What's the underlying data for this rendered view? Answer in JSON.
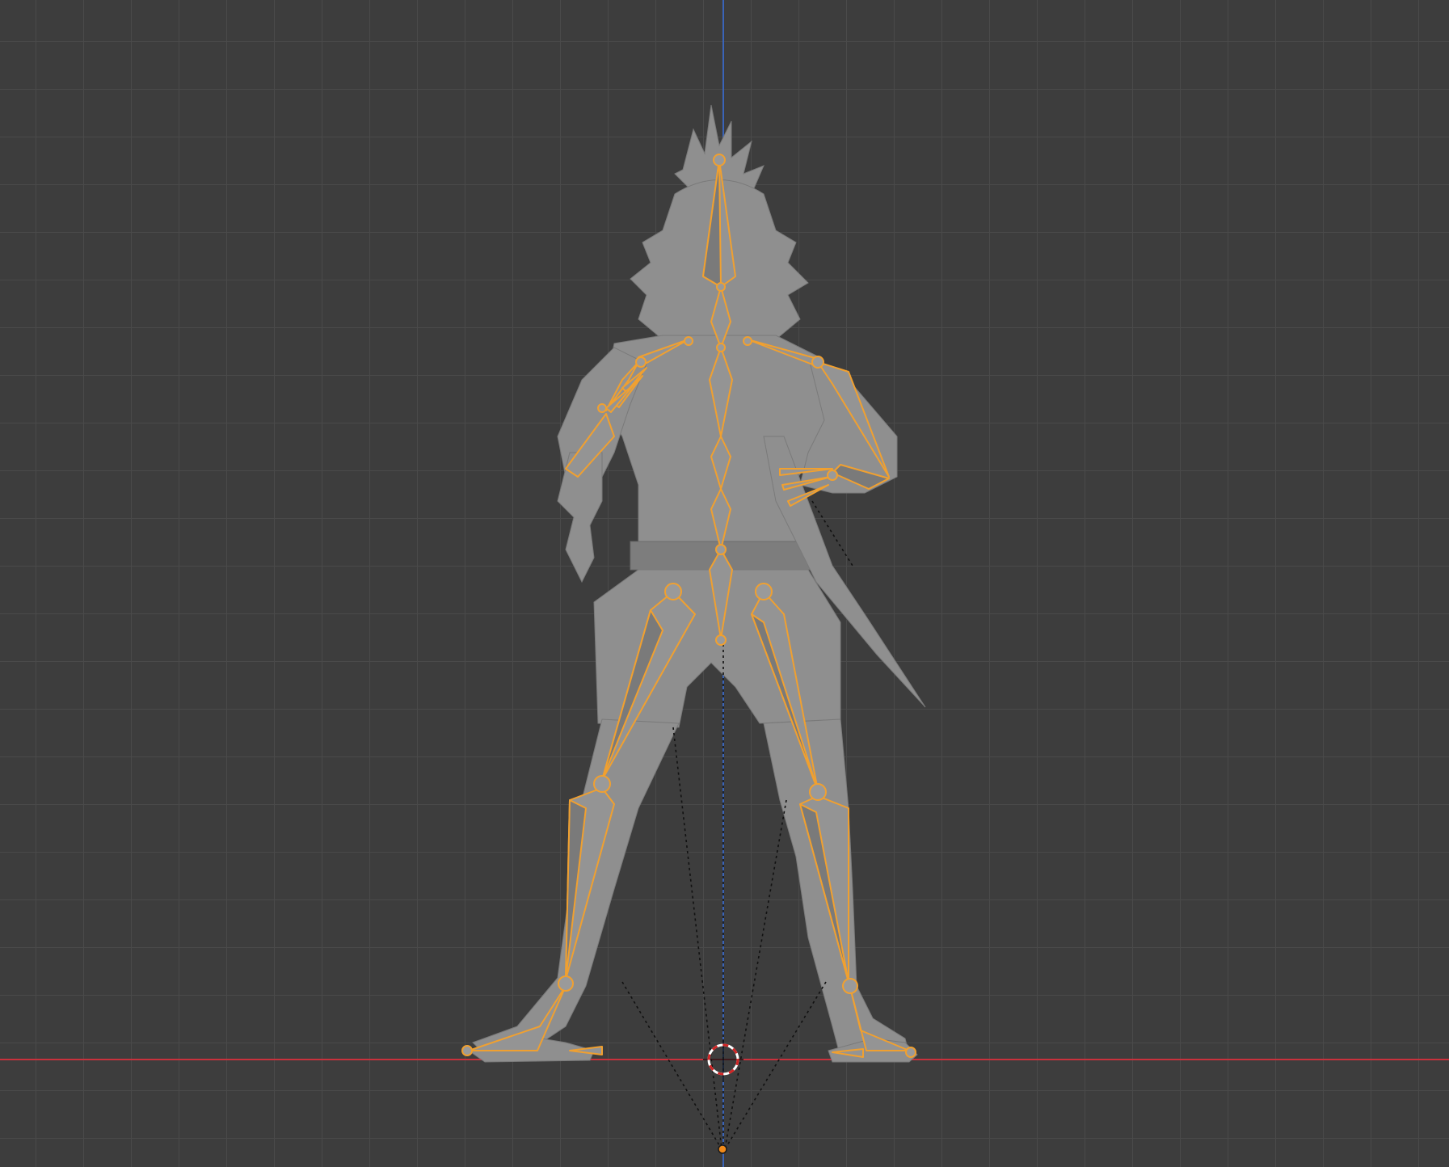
{
  "viewport": {
    "background_color": "#3d3d3d",
    "grid_color": "#4a4a4a",
    "axis_x_color": "#c9313c",
    "axis_z_color": "#3a64b8",
    "bone_outline_color": "#f0a030",
    "mesh_color": "#8f8f8f",
    "cursor_icon": "3d-cursor-icon",
    "origin_icon": "armature-origin-icon"
  }
}
